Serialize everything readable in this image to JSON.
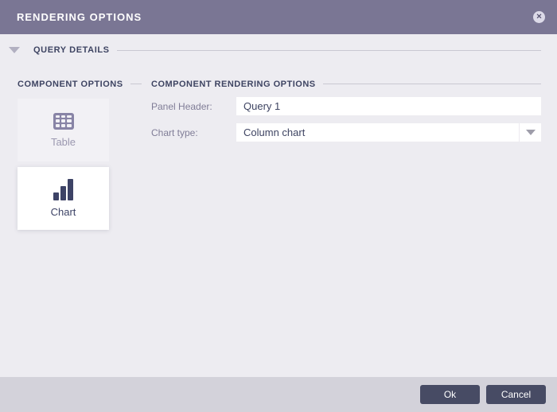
{
  "header": {
    "title": "RENDERING OPTIONS",
    "close_glyph": "✕"
  },
  "query_details": {
    "label": "QUERY DETAILS"
  },
  "component_options": {
    "title": "COMPONENT OPTIONS",
    "items": [
      {
        "label": "Table",
        "icon": "table-grid-icon",
        "selected": false
      },
      {
        "label": "Chart",
        "icon": "bar-chart-icon",
        "selected": true
      }
    ]
  },
  "rendering_options": {
    "title": "COMPONENT RENDERING OPTIONS",
    "panel_header": {
      "label": "Panel Header:",
      "value": "Query 1"
    },
    "chart_type": {
      "label": "Chart type:",
      "value": "Column chart"
    }
  },
  "footer": {
    "ok": "Ok",
    "cancel": "Cancel"
  },
  "colors": {
    "header_bg": "#7a7694",
    "accent_dark": "#3e4462",
    "page_bg": "#edecf1",
    "footer_bg": "#d3d2da",
    "button_bg": "#474b64"
  }
}
